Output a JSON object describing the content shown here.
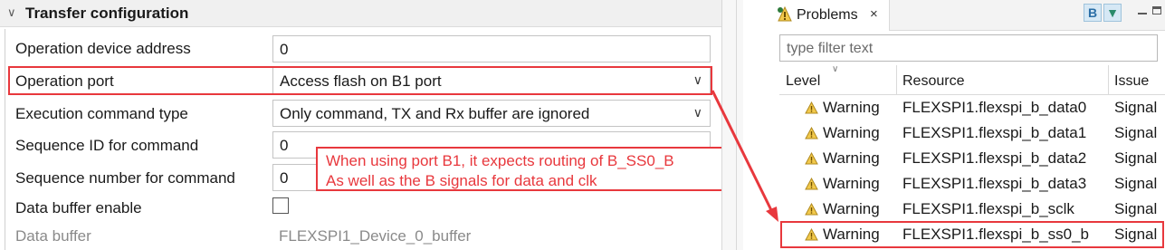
{
  "left": {
    "section_title": "Transfer configuration",
    "rows": [
      {
        "label": "Operation device address",
        "value": "0"
      },
      {
        "label": "Operation port",
        "value": "Access flash on B1 port"
      },
      {
        "label": "Execution command type",
        "value": "Only command, TX and Rx buffer are ignored"
      },
      {
        "label": "Sequence ID for command",
        "value": "0"
      },
      {
        "label": "Sequence number for command",
        "value": "0"
      },
      {
        "label": "Data buffer enable",
        "value": ""
      },
      {
        "label": "Data buffer",
        "value": "FLEXSPI1_Device_0_buffer"
      }
    ],
    "data_buffer_enable_checked": false
  },
  "annotation": {
    "line1": "When using port B1, it expects routing of B_SS0_B",
    "line2": "As well as the B signals for data and clk",
    "color": "#e8383d"
  },
  "problems": {
    "tab_title": "Problems",
    "toolbar_b": "B",
    "filter_placeholder": "type filter text",
    "columns": [
      "Level",
      "Resource",
      "Issue"
    ],
    "rows": [
      {
        "level": "Warning",
        "resource": "FLEXSPI1.flexspi_b_data0",
        "issue": "Signal"
      },
      {
        "level": "Warning",
        "resource": "FLEXSPI1.flexspi_b_data1",
        "issue": "Signal"
      },
      {
        "level": "Warning",
        "resource": "FLEXSPI1.flexspi_b_data2",
        "issue": "Signal"
      },
      {
        "level": "Warning",
        "resource": "FLEXSPI1.flexspi_b_data3",
        "issue": "Signal"
      },
      {
        "level": "Warning",
        "resource": "FLEXSPI1.flexspi_b_sclk",
        "issue": "Signal"
      },
      {
        "level": "Warning",
        "resource": "FLEXSPI1.flexspi_b_ss0_b",
        "issue": "Signal"
      }
    ]
  }
}
